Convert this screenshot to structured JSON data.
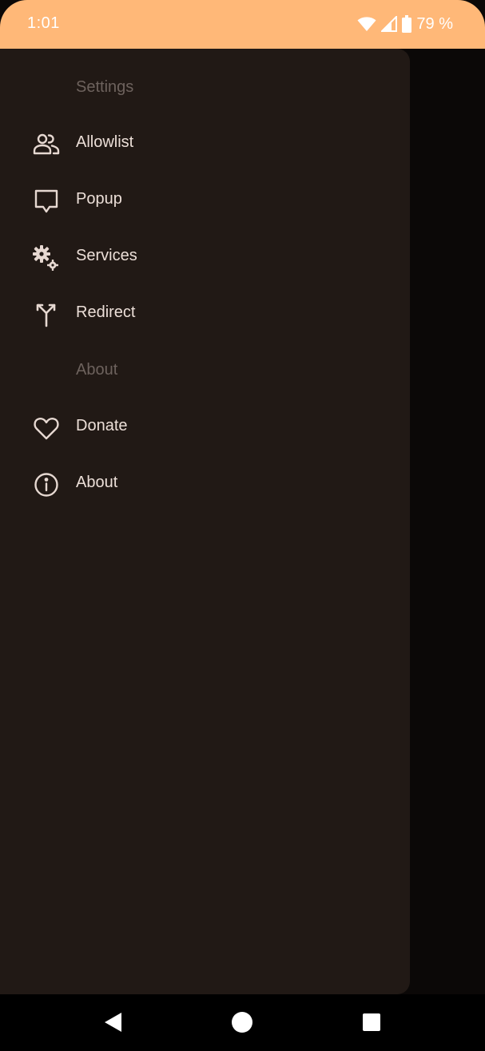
{
  "status_bar": {
    "time": "1:01",
    "battery_text": "79 %",
    "icons": [
      "wifi-icon",
      "signal-icon",
      "battery-icon"
    ],
    "background_color": "#ffb878"
  },
  "drawer": {
    "sections": [
      {
        "header": "Settings",
        "items": [
          {
            "label": "Allowlist",
            "icon": "people-icon"
          },
          {
            "label": "Popup",
            "icon": "chat-bubble-icon"
          },
          {
            "label": "Services",
            "icon": "gears-icon"
          },
          {
            "label": "Redirect",
            "icon": "fork-arrows-icon"
          }
        ]
      },
      {
        "header": "About",
        "items": [
          {
            "label": "Donate",
            "icon": "heart-icon"
          },
          {
            "label": "About",
            "icon": "info-icon"
          }
        ]
      }
    ],
    "background_color": "#211915"
  },
  "nav_bar": {
    "buttons": [
      "back-icon",
      "home-icon",
      "recents-icon"
    ]
  }
}
